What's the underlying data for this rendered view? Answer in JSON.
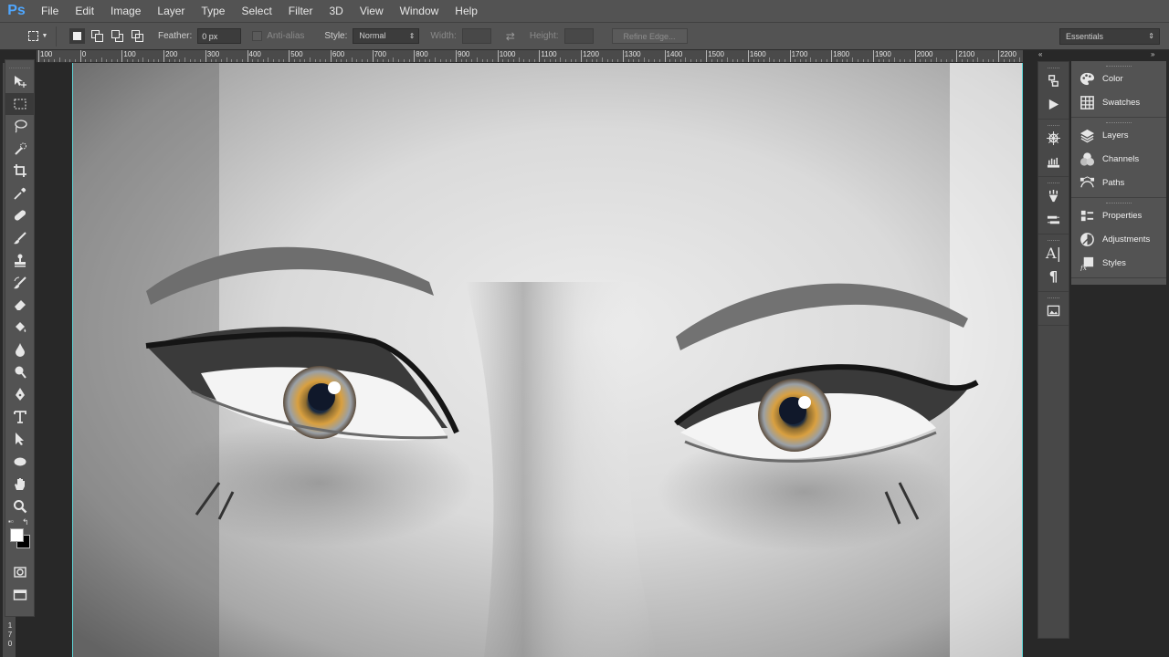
{
  "app": {
    "logo": "Ps",
    "menu": [
      "File",
      "Edit",
      "Image",
      "Layer",
      "Type",
      "Select",
      "Filter",
      "3D",
      "View",
      "Window",
      "Help"
    ]
  },
  "options": {
    "feather_label": "Feather:",
    "feather_value": "0 px",
    "antialias_label": "Anti-alias",
    "style_label": "Style:",
    "style_value": "Normal",
    "width_label": "Width:",
    "height_label": "Height:",
    "refine_edge_label": "Refine Edge...",
    "workspace_value": "Essentials"
  },
  "ruler": {
    "horizontal_labels": [
      "100",
      "0",
      "100",
      "200",
      "300",
      "400",
      "500",
      "600",
      "700",
      "800",
      "900",
      "1000",
      "1100",
      "1200",
      "1300",
      "1400",
      "1500",
      "1600",
      "1700",
      "1800",
      "1900",
      "2000",
      "2100",
      "2200"
    ],
    "vertical_labels": [
      "1",
      "7",
      "0"
    ]
  },
  "tools": [
    {
      "name": "move-tool",
      "icon": "move-icon"
    },
    {
      "name": "rectangular-marquee-tool",
      "icon": "marquee-icon",
      "selected": true
    },
    {
      "name": "lasso-tool",
      "icon": "lasso-icon"
    },
    {
      "name": "quick-selection-tool",
      "icon": "quick-select-icon"
    },
    {
      "name": "crop-tool",
      "icon": "crop-icon"
    },
    {
      "name": "eyedropper-tool",
      "icon": "eyedropper-icon"
    },
    {
      "name": "healing-brush-tool",
      "icon": "bandage-icon"
    },
    {
      "name": "brush-tool",
      "icon": "brush-icon"
    },
    {
      "name": "clone-stamp-tool",
      "icon": "stamp-icon"
    },
    {
      "name": "history-brush-tool",
      "icon": "history-brush-icon"
    },
    {
      "name": "eraser-tool",
      "icon": "eraser-icon"
    },
    {
      "name": "paint-bucket-tool",
      "icon": "bucket-icon"
    },
    {
      "name": "blur-tool",
      "icon": "blur-drop-icon"
    },
    {
      "name": "dodge-tool",
      "icon": "dodge-icon"
    },
    {
      "name": "pen-tool",
      "icon": "pen-icon"
    },
    {
      "name": "type-tool",
      "icon": "type-icon"
    },
    {
      "name": "path-selection-tool",
      "icon": "arrow-icon"
    },
    {
      "name": "ellipse-tool",
      "icon": "ellipse-icon"
    },
    {
      "name": "hand-tool",
      "icon": "hand-icon"
    },
    {
      "name": "zoom-tool",
      "icon": "zoom-icon"
    }
  ],
  "colors": {
    "foreground": "#ffffff",
    "background": "#000000",
    "guide": "#5fd4d6",
    "iris": "#d99a3a"
  },
  "dock_icons": [
    "history-icon",
    "actions-play-icon",
    "compass-icon",
    "brush-presets-icon",
    "tool-presets-icon",
    "layer-comps-icon",
    "character-icon",
    "paragraph-icon",
    "image-icon"
  ],
  "panels": [
    {
      "label": "Color",
      "icon": "color-palette-icon"
    },
    {
      "label": "Swatches",
      "icon": "swatches-grid-icon"
    },
    {
      "label": "Layers",
      "icon": "layers-stack-icon"
    },
    {
      "label": "Channels",
      "icon": "channels-icon"
    },
    {
      "label": "Paths",
      "icon": "paths-icon"
    },
    {
      "label": "Properties",
      "icon": "properties-icon"
    },
    {
      "label": "Adjustments",
      "icon": "adjustments-icon"
    },
    {
      "label": "Styles",
      "icon": "fx-styles-icon"
    }
  ]
}
